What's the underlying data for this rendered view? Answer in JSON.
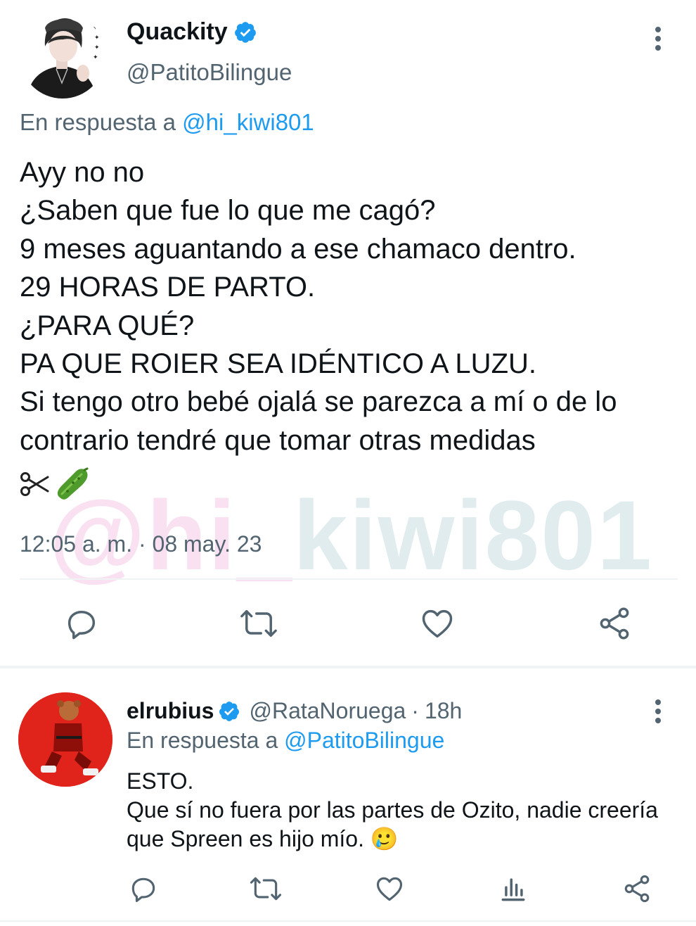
{
  "main_tweet": {
    "display_name": "Quackity",
    "handle": "@PatitoBilingue",
    "reply_prefix": "En respuesta a",
    "reply_mention": "@hi_kiwi801",
    "text": "Ayy no no\n¿Saben que fue lo que me cagó?\n9 meses aguantando a ese chamaco dentro.\n29 HORAS DE PARTO.\n¿PARA QUÉ?\nPA QUE ROIER SEA IDÉNTICO A LUZU.\nSi tengo otro bebé ojalá se parezca a mí o de lo contrario tendré que tomar otras medidas",
    "emojis": [
      "scissors-icon",
      "cucumber-icon"
    ],
    "timestamp": "12:05 a. m. · 08 may. 23",
    "watermark_a": "@hi_",
    "watermark_b": "kiwi801",
    "actions": [
      "reply-icon",
      "retweet-icon",
      "like-icon",
      "share-icon"
    ]
  },
  "reply_tweet": {
    "display_name": "elrubius",
    "handle": "@RataNoruega",
    "time_sep": "·",
    "time": "18h",
    "reply_prefix": "En respuesta a",
    "reply_mention": "@PatitoBilingue",
    "text": "ESTO.\nQue sí no fuera por las partes de Ozito, nadie creería que Spreen es hijo mío. 🥲",
    "actions": [
      "reply-icon",
      "retweet-icon",
      "like-icon",
      "analytics-icon",
      "share-icon"
    ]
  },
  "colors": {
    "text": "#0f1419",
    "secondary": "#536471",
    "accent": "#1d9bf0",
    "divider": "#eff3f4",
    "reply_avatar_bg": "#e0231b"
  }
}
